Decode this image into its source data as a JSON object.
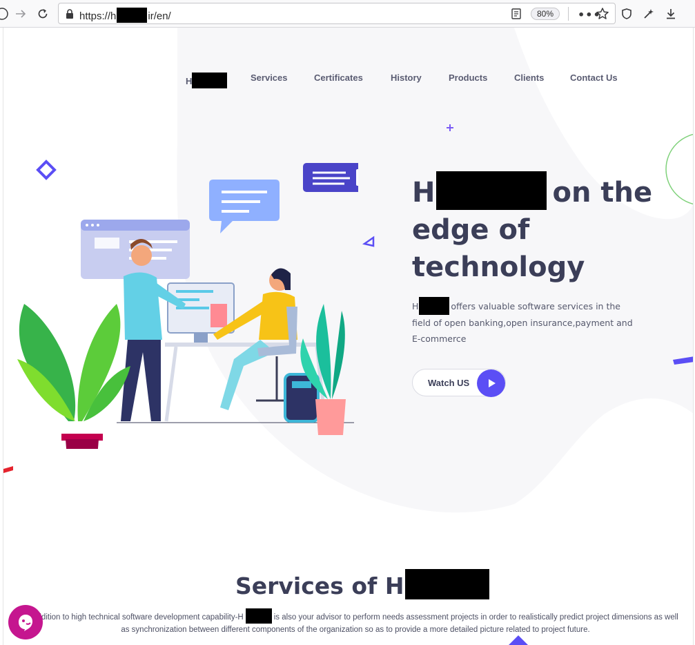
{
  "browser": {
    "url_prefix": "https://h",
    "url_suffix": "ir/en/",
    "zoom": "80%",
    "icons": [
      "back-icon",
      "forward-icon",
      "reload-icon",
      "lock-icon",
      "reader-view-icon",
      "more-actions-icon",
      "bookmark-star-icon",
      "shield-icon",
      "extensions-icon",
      "download-icon"
    ]
  },
  "nav": {
    "home_prefix": "H",
    "items": [
      "Services",
      "Certificates",
      "History",
      "Products",
      "Clients",
      "Contact Us"
    ]
  },
  "hero": {
    "title_prefix": "H",
    "title_rest": "on the edge of technology",
    "desc_prefix": "H",
    "desc_rest": "offers valuable software services in the field of open banking,open insurance,payment and E-commerce",
    "watch_label": "Watch US"
  },
  "services": {
    "title_prefix": "Services of H",
    "desc_start": "addition to high technical software development capability-H",
    "desc_end": "is also your advisor to perform needs assessment projects in order to realistically predict project dimensions as well as synchronization between different components of the organization so as to provide a more detailed picture related to project future."
  },
  "colors": {
    "accent": "#5b4ef5",
    "heading": "#3b3e58",
    "chat": "#c5168f",
    "bg_blob": "#f7f7f9"
  }
}
